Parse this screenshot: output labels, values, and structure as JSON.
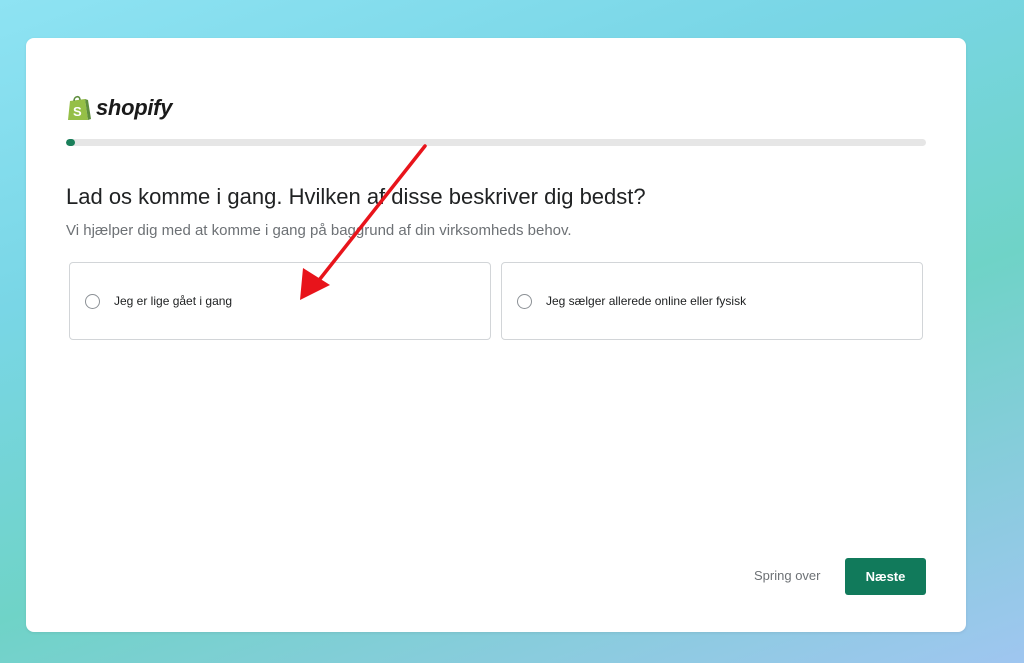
{
  "brand": {
    "logo_text": "shopify",
    "logo_color": "#95bf47"
  },
  "progress": {
    "value_fraction": 0.01,
    "color": "#1a7f5a"
  },
  "question": {
    "title": "Lad os komme i gang. Hvilken af disse beskriver dig bedst?",
    "subtitle": "Vi hjælper dig med at komme i gang på baggrund af din virksomheds behov."
  },
  "options": [
    {
      "label": "Jeg er lige gået i gang",
      "selected": false
    },
    {
      "label": "Jeg sælger allerede online eller fysisk",
      "selected": false
    }
  ],
  "footer": {
    "skip_label": "Spring over",
    "next_label": "Næste",
    "next_color": "#117a5b"
  },
  "annotation": {
    "type": "arrow",
    "color": "#e8141b"
  }
}
